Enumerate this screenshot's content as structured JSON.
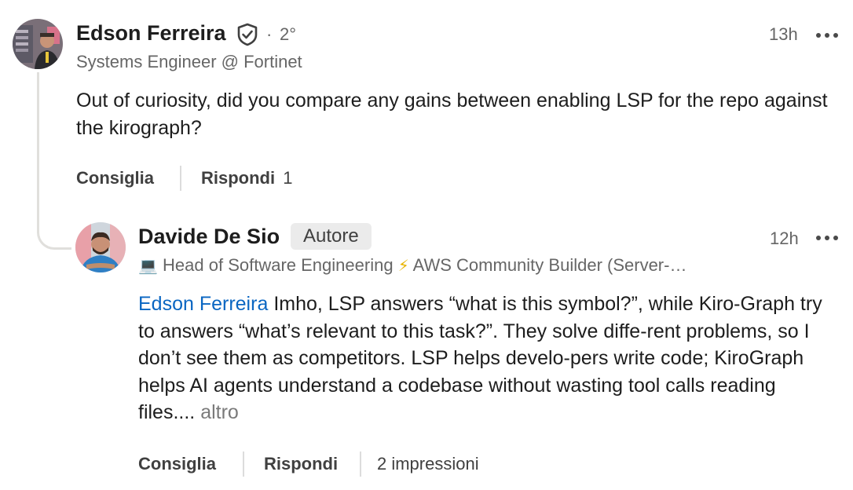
{
  "comment": {
    "author": {
      "name": "Edson Ferreira",
      "degree": "2°",
      "dot": "·",
      "headline": "Systems Engineer @ Fortinet"
    },
    "time": "13h",
    "text": "Out of curiosity, did you compare any gains between enabling LSP for the repo against the kirograph?",
    "actions": {
      "like_label": "Consiglia",
      "reply_label": "Rispondi",
      "reply_count": "1"
    }
  },
  "reply": {
    "author": {
      "name": "Davide De Sio",
      "badge": "Autore",
      "headline_emoji_1": "💻",
      "headline_part_1": "Head of Software Engineering",
      "headline_emoji_2": "⚡",
      "headline_part_2": "AWS Community Builder (Server-…"
    },
    "time": "12h",
    "mention": "Edson Ferreira",
    "text": "Imho, LSP answers “what is this symbol?”, while Kiro-Graph try to answers “what’s relevant to this task?”. They solve diffe-rent problems, so I don’t see them as competitors. LSP helps develo-pers write code; KiroGraph helps AI agents understand a codebase without wasting tool calls reading files....",
    "see_more": "altro",
    "actions": {
      "like_label": "Consiglia",
      "reply_label": "Rispondi",
      "impressions": "2 impressioni"
    }
  },
  "icons": {
    "verified": "shield-check-icon",
    "more": "more-horizontal-icon"
  },
  "colors": {
    "mention": "#0a66c2",
    "secondary_text": "#666666",
    "badge_bg": "#ebebeb"
  }
}
